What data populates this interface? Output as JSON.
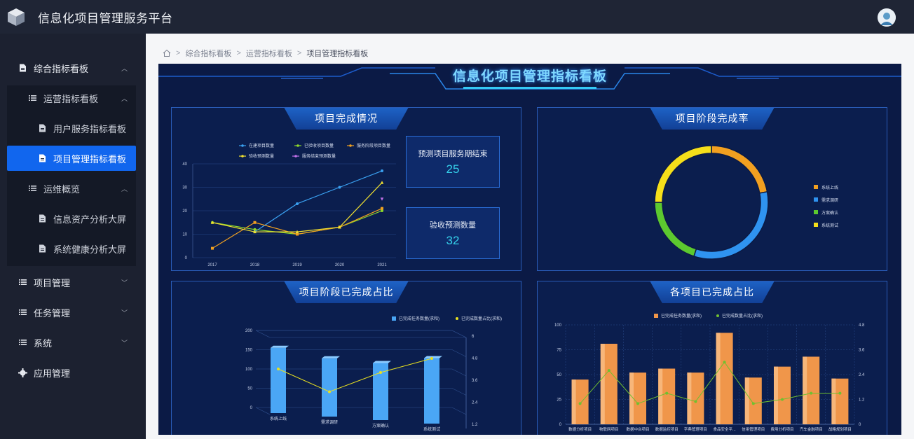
{
  "app": {
    "title": "信息化项目管理服务平台"
  },
  "sidebar": {
    "items": [
      {
        "label": "综合指标看板",
        "level": 1,
        "icon": "document-icon",
        "caret": "up"
      },
      {
        "label": "运营指标看板",
        "level": 2,
        "icon": "list-icon",
        "caret": "up"
      },
      {
        "label": "用户服务指标看板",
        "level": 3,
        "icon": "document-icon"
      },
      {
        "label": "项目管理指标看板",
        "level": 3,
        "icon": "document-icon",
        "active": true
      },
      {
        "label": "运维概览",
        "level": 2,
        "icon": "list-icon",
        "caret": "up"
      },
      {
        "label": "信息资产分析大屏",
        "level": 3,
        "icon": "document-icon"
      },
      {
        "label": "系统健康分析大屏",
        "level": 3,
        "icon": "document-icon"
      },
      {
        "label": "项目管理",
        "level": 1,
        "icon": "list-icon",
        "caret": "down"
      },
      {
        "label": "任务管理",
        "level": 1,
        "icon": "list-icon",
        "caret": "down"
      },
      {
        "label": "系统",
        "level": 1,
        "icon": "list-icon",
        "caret": "down"
      },
      {
        "label": "应用管理",
        "level": 1,
        "icon": "gear-icon"
      }
    ]
  },
  "breadcrumb": [
    "综合指标看板",
    "运营指标看板",
    "项目管理指标看板"
  ],
  "dashboard": {
    "title": "信息化项目管理指标看板",
    "colors": {
      "accent": "#1166ee",
      "background": "#0b1a45"
    },
    "panels": {
      "completion": {
        "title": "项目完成情况"
      },
      "stage_rate": {
        "title": "项目阶段完成率"
      },
      "stage_done": {
        "title": "项目阶段已完成占比"
      },
      "project_done": {
        "title": "各项目已完成占比"
      }
    },
    "stats": [
      {
        "label": "预测项目服务期结束",
        "value": "25"
      },
      {
        "label": "验收预测数量",
        "value": "32"
      }
    ]
  },
  "chart_data": [
    {
      "type": "line",
      "x": [
        "2017",
        "2018",
        "2019",
        "2020",
        "2021"
      ],
      "ylim": [
        0,
        40
      ],
      "yticks": [
        0,
        10,
        20,
        30,
        40
      ],
      "series": [
        {
          "name": "在建项目数量",
          "color": "#3aa0f0",
          "values": [
            null,
            11,
            23,
            30,
            37
          ]
        },
        {
          "name": "已验收项目数量",
          "color": "#8ed82a",
          "values": [
            15,
            12,
            10,
            13,
            20
          ]
        },
        {
          "name": "服务阶段项目数量",
          "color": "#f0a020",
          "values": [
            4,
            15,
            10,
            13,
            21
          ]
        },
        {
          "name": "验收预测数量",
          "color": "#f0e030",
          "values": [
            15,
            11,
            11,
            13,
            32
          ]
        },
        {
          "name": "服务结束预测数量",
          "color": "#c070e8",
          "values": [
            null,
            null,
            null,
            null,
            25
          ]
        }
      ]
    },
    {
      "type": "pie",
      "donut": true,
      "legend": "right",
      "slices": [
        {
          "label": "系统上线",
          "value": 22,
          "color": "#f2a020"
        },
        {
          "label": "需求调研",
          "value": 33,
          "color": "#2f93f0"
        },
        {
          "label": "方案确认",
          "value": 20,
          "color": "#5cc92f"
        },
        {
          "label": "系统测试",
          "value": 25,
          "color": "#f5df1a"
        }
      ]
    },
    {
      "type": "bar",
      "style": "3d",
      "categories": [
        "系统上线",
        "需求调研",
        "方案确认",
        "系统测试"
      ],
      "ylim": [
        0,
        200
      ],
      "yticks": [
        0,
        50,
        100,
        150,
        200
      ],
      "y2ticks": [
        1.2,
        2.4,
        3.6,
        4.8,
        6
      ],
      "series": [
        {
          "name": "已完成任务数量(求和)",
          "color": "#4aa6f5",
          "values": [
            155,
            135,
            130,
            150
          ]
        },
        {
          "name": "已完成数量占比(求和)",
          "color": "#e8e020",
          "axis": "right",
          "values": [
            3.8,
            2.5,
            3.6,
            4.4
          ]
        }
      ]
    },
    {
      "type": "bar",
      "categories": [
        "数据分析项目",
        "物联网项目",
        "数据中台项目",
        "数据监控项目",
        "字典管理项目",
        "食品安全平...",
        "信用管理项目",
        "费用分析项目",
        "汽车金融项目",
        "战略规划项目"
      ],
      "ylim": [
        0,
        100
      ],
      "yticks": [
        0,
        25,
        50,
        75,
        100
      ],
      "y2ticks": [
        0,
        1.2,
        2.4,
        3.6,
        4.8
      ],
      "series": [
        {
          "name": "已完成任务数量(求和)",
          "color": "#f0964a",
          "values": [
            45,
            81,
            52,
            56,
            52,
            92,
            47,
            58,
            68,
            46
          ]
        },
        {
          "name": "已完成数量占比(求和)",
          "color": "#70c030",
          "axis": "right",
          "values": [
            1.0,
            2.6,
            1.0,
            1.5,
            1.1,
            3.0,
            1.0,
            1.2,
            1.5,
            1.5
          ]
        }
      ]
    }
  ]
}
